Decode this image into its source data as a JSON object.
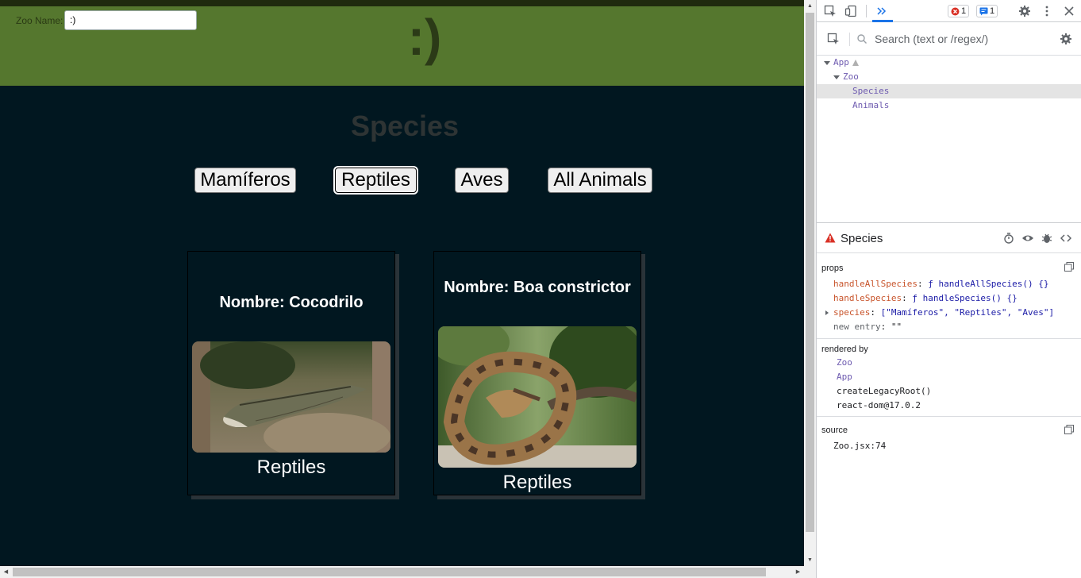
{
  "page": {
    "zoo_label": "Zoo Name:",
    "zoo_value": ":)",
    "zoo_heading": ":)",
    "species_title": "Species",
    "filter_buttons": [
      {
        "label": "Mamíferos",
        "active": false
      },
      {
        "label": "Reptiles",
        "active": true
      },
      {
        "label": "Aves",
        "active": false
      },
      {
        "label": "All Animals",
        "active": false
      }
    ],
    "cards": [
      {
        "name": "Nombre: Cocodrilo",
        "kind": "Reptiles",
        "image": "crocodile"
      },
      {
        "name": "Nombre: Boa constrictor",
        "kind": "Reptiles",
        "image": "boa-constrictor"
      }
    ]
  },
  "devtools": {
    "error_count": "1",
    "message_count": "1",
    "search_placeholder": "Search (text or /regex/)",
    "tree": [
      {
        "label": "App",
        "depth": 0,
        "expanded": true,
        "warning": true
      },
      {
        "label": "Zoo",
        "depth": 1,
        "expanded": true
      },
      {
        "label": "Species",
        "depth": 2,
        "selected": true
      },
      {
        "label": "Animals",
        "depth": 2
      }
    ],
    "selected_component": "Species",
    "props_label": "props",
    "props": [
      {
        "key": "handleAllSpecies",
        "value": "ƒ handleAllSpecies() {}"
      },
      {
        "key": "handleSpecies",
        "value": "ƒ handleSpecies() {}"
      },
      {
        "key": "species",
        "value": "[\"Mamíferos\", \"Reptiles\", \"Aves\"]"
      },
      {
        "key": "new entry",
        "value": "\"\""
      }
    ],
    "rendered_by_label": "rendered by",
    "rendered_by": [
      "Zoo",
      "App",
      "createLegacyRoot()",
      "react-dom@17.0.2"
    ],
    "source_label": "source",
    "source": "Zoo.jsx:74"
  },
  "colors": {
    "header_green": "#55772e",
    "page_bg": "#011720",
    "devtools_accent": "#1a73e8",
    "error_red": "#d93025"
  }
}
